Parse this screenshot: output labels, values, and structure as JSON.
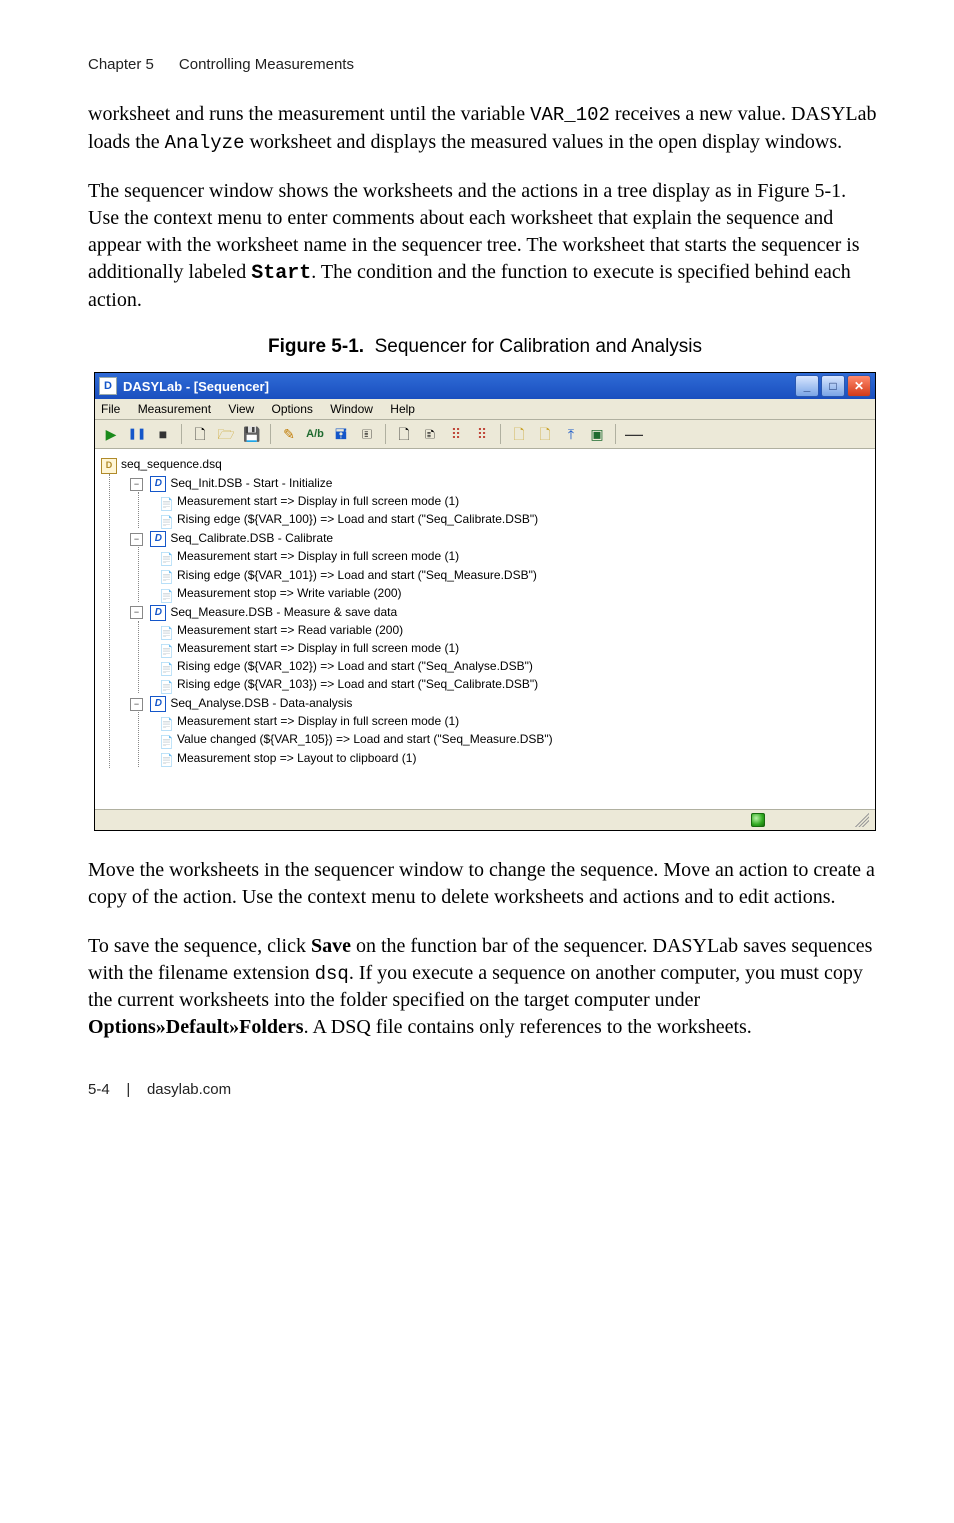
{
  "header": {
    "chapter": "Chapter 5",
    "section": "Controlling Measurements"
  },
  "paragraphs": {
    "p1a": "worksheet and runs the measurement until the variable ",
    "p1_code1": "VAR_102",
    "p1b": " receives a new value. DASYLab loads the ",
    "p1_code2": "Analyze",
    "p1c": " worksheet and displays the measured values in the open display windows.",
    "p2a": "The sequencer window shows the worksheets and the actions in a tree display as in Figure 5-1. Use the context menu to enter comments about each worksheet that explain the sequence and appear with the worksheet name in the sequencer tree. The worksheet that starts the sequencer is additionally labeled ",
    "p2_code1": "Start",
    "p2b": ". The condition and the function to execute is specified behind each action.",
    "p3": "Move the worksheets in the sequencer window to change the sequence. Move an action to create a copy of the action. Use the context menu to delete worksheets and actions and to edit actions.",
    "p4a": "To save the sequence, click ",
    "p4_bold1": "Save",
    "p4b": " on the function bar of the sequencer. DASYLab saves sequences with the filename extension ",
    "p4_code1": "dsq",
    "p4c": ". If you execute a sequence on another computer, you must copy the current worksheets into the folder specified on the target computer under ",
    "p4_bold2": "Options»Default»Folders",
    "p4d": ". A DSQ file contains only references to the worksheets."
  },
  "figure": {
    "label": "Figure 5-1.",
    "caption": "Sequencer for Calibration and Analysis"
  },
  "window": {
    "title": "DASYLab - [Sequencer]",
    "menu": [
      "File",
      "Measurement",
      "View",
      "Options",
      "Window",
      "Help"
    ],
    "toolbar_icons": [
      "▶",
      "❚❚",
      "■",
      "",
      "🗋",
      "🗁",
      "💾",
      "",
      "✎",
      "A/b",
      "🖬",
      "🗉",
      "",
      "🗋",
      "🗈",
      "⠿",
      "⠿",
      "",
      "🗋",
      "🗋",
      "⤒",
      "▣",
      "",
      "—"
    ],
    "tree": {
      "root": "seq_sequence.dsq",
      "nodes": [
        {
          "label": "Seq_Init.DSB - Start - Initialize",
          "actions": [
            "Measurement start   =>   Display in full screen mode (1)",
            "Rising edge (${VAR_100})   =>   Load and start (\"Seq_Calibrate.DSB\")"
          ]
        },
        {
          "label": "Seq_Calibrate.DSB - Calibrate",
          "actions": [
            "Measurement start   =>   Display in full screen mode (1)",
            "Rising edge (${VAR_101})   =>   Load and start (\"Seq_Measure.DSB\")",
            "Measurement stop   =>   Write variable (200)"
          ]
        },
        {
          "label": "Seq_Measure.DSB - Measure & save data",
          "actions": [
            "Measurement start   =>   Read variable (200)",
            "Measurement start   =>   Display in full screen mode (1)",
            "Rising edge (${VAR_102})   =>   Load and start (\"Seq_Analyse.DSB\")",
            "Rising edge (${VAR_103})   =>   Load and start (\"Seq_Calibrate.DSB\")"
          ]
        },
        {
          "label": "Seq_Analyse.DSB - Data-analysis",
          "actions": [
            "Measurement start   =>   Display in full screen mode (1)",
            "Value changed (${VAR_105})   =>   Load and start (\"Seq_Measure.DSB\")",
            "Measurement stop   =>   Layout to clipboard (1)"
          ]
        }
      ]
    }
  },
  "footer": {
    "page": "5-4",
    "sep": "|",
    "site": "dasylab.com"
  }
}
